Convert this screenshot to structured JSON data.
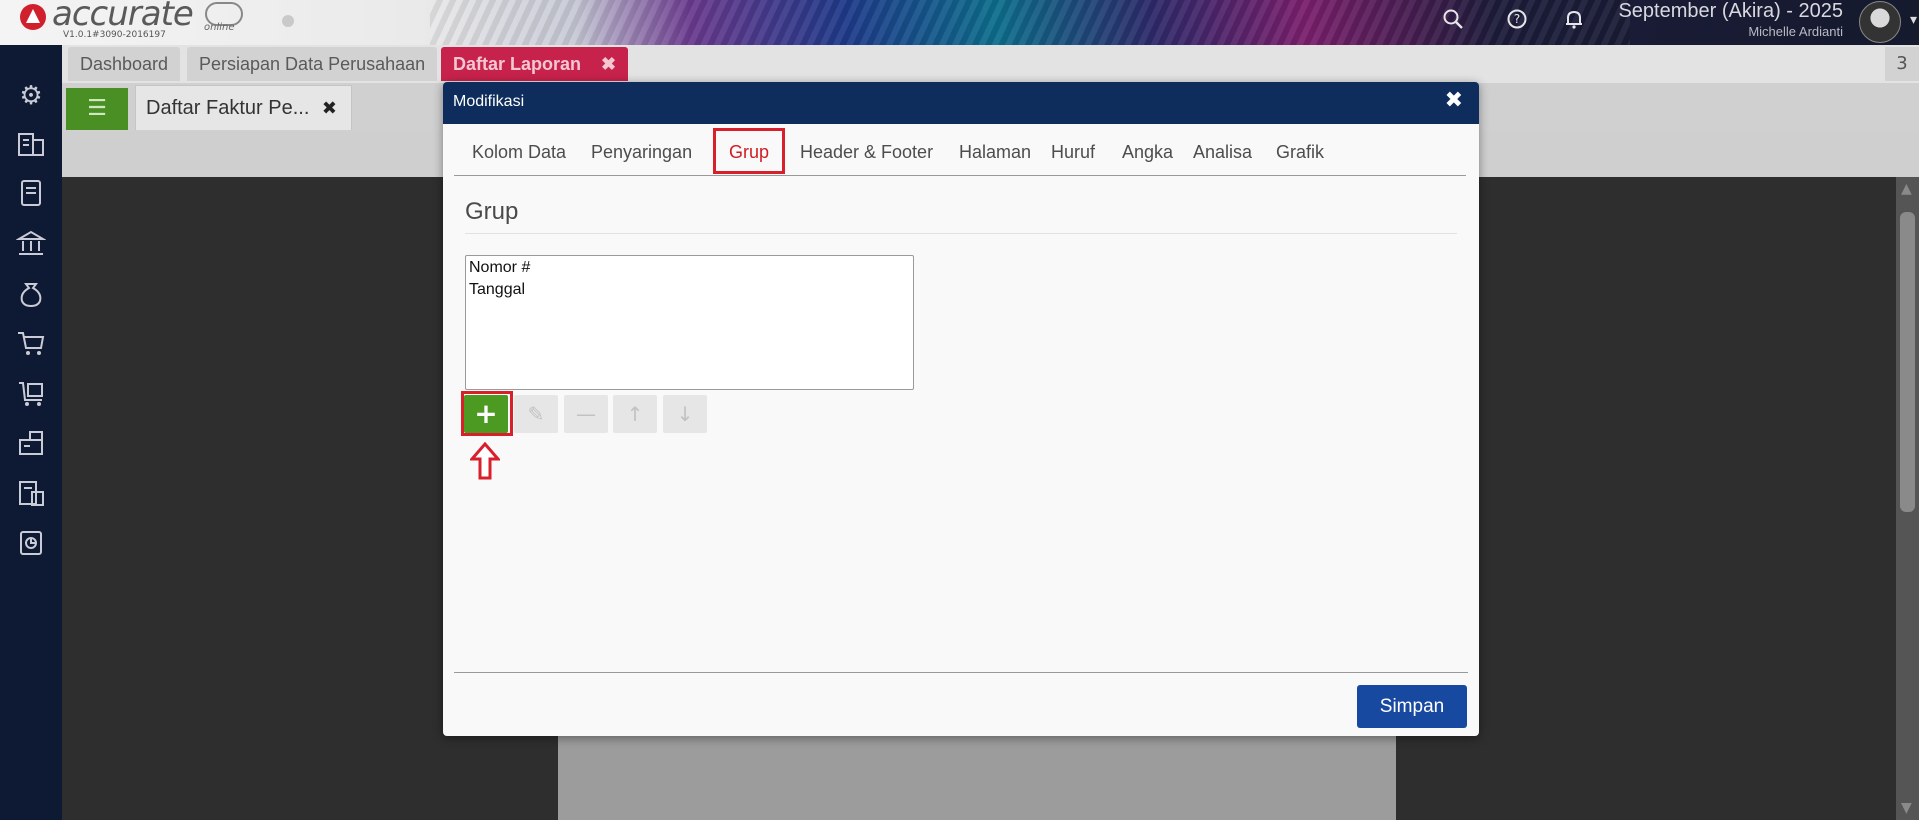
{
  "header": {
    "logo_text": "accurate",
    "logo_sub": "online",
    "version": "V1.0.1#3090-2016197",
    "company": "September (Akira) - 2025",
    "user": "Michelle Ardianti",
    "icons": [
      "search-icon",
      "help-icon",
      "bell-icon"
    ]
  },
  "sidebar": {
    "icons": [
      "gear-icon",
      "company-icon",
      "ledger-icon",
      "bank-icon",
      "money-bag-icon",
      "cart-icon",
      "purchase-icon",
      "warehouse-icon",
      "tax-icon",
      "report-icon"
    ]
  },
  "tabs": [
    {
      "label": "Dashboard"
    },
    {
      "label": "Persiapan Data Perusahaan"
    },
    {
      "label": "Daftar Laporan",
      "close": "✖"
    }
  ],
  "tab_count": "3",
  "doc_tab": {
    "label": "Daftar Faktur Pe...",
    "close": "✖"
  },
  "modal": {
    "title": "Modifikasi",
    "close": "✖",
    "tabs": [
      {
        "label": "Kolom Data"
      },
      {
        "label": "Penyaringan"
      },
      {
        "label": "Grup"
      },
      {
        "label": "Header & Footer"
      },
      {
        "label": "Halaman"
      },
      {
        "label": "Huruf"
      },
      {
        "label": "Angka"
      },
      {
        "label": "Analisa"
      },
      {
        "label": "Grafik"
      }
    ],
    "active_tab": "Grup",
    "section_title": "Grup",
    "list_items": [
      "Nomor #",
      "Tanggal"
    ],
    "toolbar": {
      "add": "+",
      "edit": "✎",
      "remove": "—",
      "up": "↑",
      "down": "↓"
    },
    "save_label": "Simpan"
  },
  "colors": {
    "accent_red": "#d8202c",
    "modal_header": "#0e2d5c",
    "save_button": "#1849a0",
    "add_button": "#4c9a21",
    "sidebar": "#0e1a33"
  }
}
